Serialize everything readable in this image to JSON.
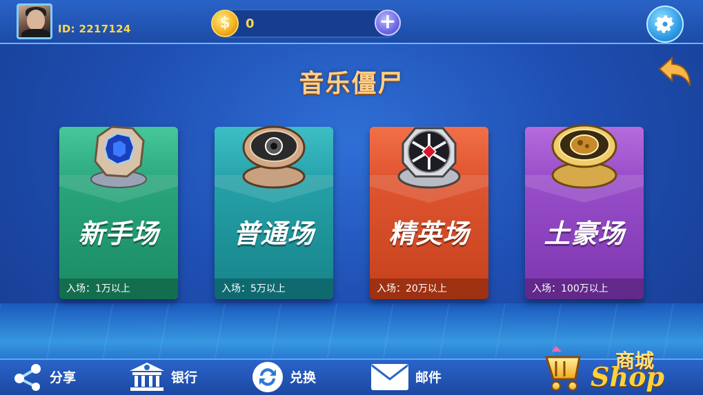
{
  "header": {
    "user_id": "ID: 2217124",
    "coins": "0",
    "add_label": "+"
  },
  "title": "音乐僵尸",
  "rooms": [
    {
      "name": "新手场",
      "entry": "入场：1万以上",
      "color": "#2aa77d"
    },
    {
      "name": "普通场",
      "entry": "入场：5万以上",
      "color": "#26a2a9"
    },
    {
      "name": "精英场",
      "entry": "入场：20万以上",
      "color": "#e05731"
    },
    {
      "name": "土豪场",
      "entry": "入场：100万以上",
      "color": "#9a4fcb"
    }
  ],
  "bottom_nav": [
    {
      "label": "分享",
      "icon": "share-icon"
    },
    {
      "label": "银行",
      "icon": "bank-icon"
    },
    {
      "label": "兑换",
      "icon": "exchange-icon"
    },
    {
      "label": "邮件",
      "icon": "mail-icon"
    }
  ],
  "shop": {
    "label": "商城",
    "sub": "Shop"
  }
}
